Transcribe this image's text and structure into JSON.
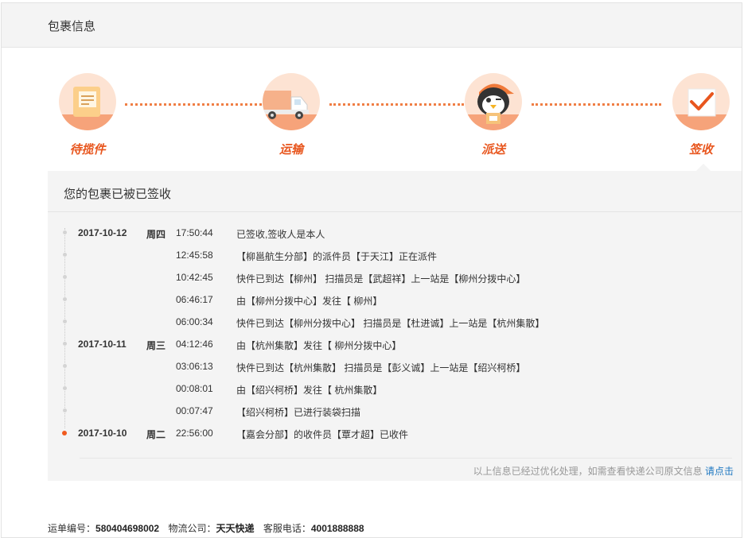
{
  "header": {
    "title": "包裹信息"
  },
  "steps": [
    {
      "label": "待揽件",
      "icon": "package-icon"
    },
    {
      "label": "运输",
      "icon": "truck-icon"
    },
    {
      "label": "派送",
      "icon": "courier-penguin-icon"
    },
    {
      "label": "签收",
      "icon": "check-signed-icon"
    }
  ],
  "status": {
    "text": "您的包裹已被已签收"
  },
  "timeline": [
    {
      "date": "2017-10-12",
      "weekday": "周四",
      "time": "17:50:44",
      "desc": "已签收,签收人是本人"
    },
    {
      "date": "",
      "weekday": "",
      "time": "12:45:58",
      "desc": "【柳邕航生分部】的派件员【于天江】正在派件"
    },
    {
      "date": "",
      "weekday": "",
      "time": "10:42:45",
      "desc": "快件已到达【柳州】 扫描员是【武超祥】上一站是【柳州分拨中心】"
    },
    {
      "date": "",
      "weekday": "",
      "time": "06:46:17",
      "desc": "由【柳州分拨中心】发往【 柳州】"
    },
    {
      "date": "",
      "weekday": "",
      "time": "06:00:34",
      "desc": "快件已到达【柳州分拨中心】 扫描员是【杜进诚】上一站是【杭州集散】"
    },
    {
      "date": "2017-10-11",
      "weekday": "周三",
      "time": "04:12:46",
      "desc": "由【杭州集散】发往【 柳州分拨中心】"
    },
    {
      "date": "",
      "weekday": "",
      "time": "03:06:13",
      "desc": "快件已到达【杭州集散】 扫描员是【彭义诚】上一站是【绍兴柯桥】"
    },
    {
      "date": "",
      "weekday": "",
      "time": "00:08:01",
      "desc": "由【绍兴柯桥】发往【 杭州集散】"
    },
    {
      "date": "",
      "weekday": "",
      "time": "00:07:47",
      "desc": "【绍兴柯桥】已进行装袋扫描"
    },
    {
      "date": "2017-10-10",
      "weekday": "周二",
      "time": "22:56:00",
      "desc": "【嘉会分部】的收件员【覃才超】已收件"
    }
  ],
  "note": {
    "text": "以上信息已经过优化处理，如需查看快递公司原文信息",
    "link": "请点击"
  },
  "footer": {
    "waybill_label": "运单编号：",
    "waybill_value": "580404698002",
    "company_label": "物流公司：",
    "company_value": "天天快递",
    "phone_label": "客服电话：",
    "phone_value": "4001888888"
  },
  "colors": {
    "accent": "#e8561e",
    "dot": "#f07e44",
    "link": "#1f78c1"
  }
}
